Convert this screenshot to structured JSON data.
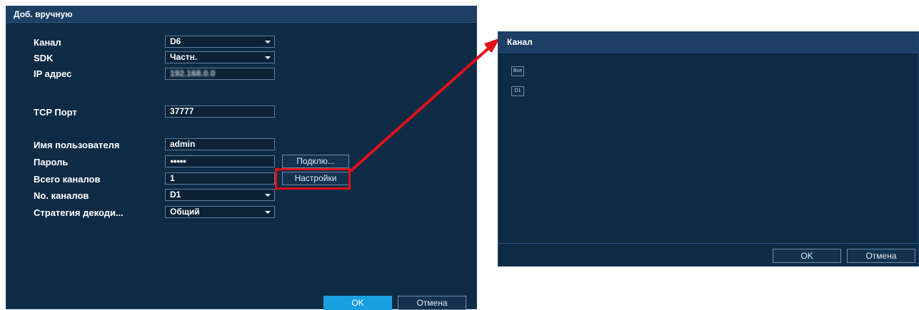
{
  "left_dialog": {
    "title": "Доб. вручную",
    "fields": {
      "channel": {
        "label": "Канал",
        "value": "D6"
      },
      "sdk": {
        "label": "SDK",
        "value": "Частн."
      },
      "ip": {
        "label": "IP адрес",
        "value": "192.168.0.0"
      },
      "tcp_port": {
        "label": "TCP Порт",
        "value": "37777"
      },
      "username": {
        "label": "Имя пользователя",
        "value": "admin"
      },
      "password": {
        "label": "Пароль",
        "value": "●●●●●"
      },
      "total_channels": {
        "label": "Всего каналов",
        "value": "1"
      },
      "channel_no": {
        "label": "No. каналов",
        "value": "D1"
      },
      "decode_strategy": {
        "label": "Стратегия декоди...",
        "value": "Общий"
      }
    },
    "connect_button": "Подклю...",
    "settings_button": "Настройки",
    "ok_button": "OK",
    "cancel_button": "Отмена"
  },
  "right_dialog": {
    "title": "Канал",
    "items": [
      "Все",
      "D1"
    ],
    "ok_button": "OK",
    "cancel_button": "Отмена"
  },
  "colors": {
    "dialog_bg": "#0e2b45",
    "titlebar_bg": "#1c3f63",
    "accent": "#19a0e0",
    "highlight": "#e0101a"
  }
}
